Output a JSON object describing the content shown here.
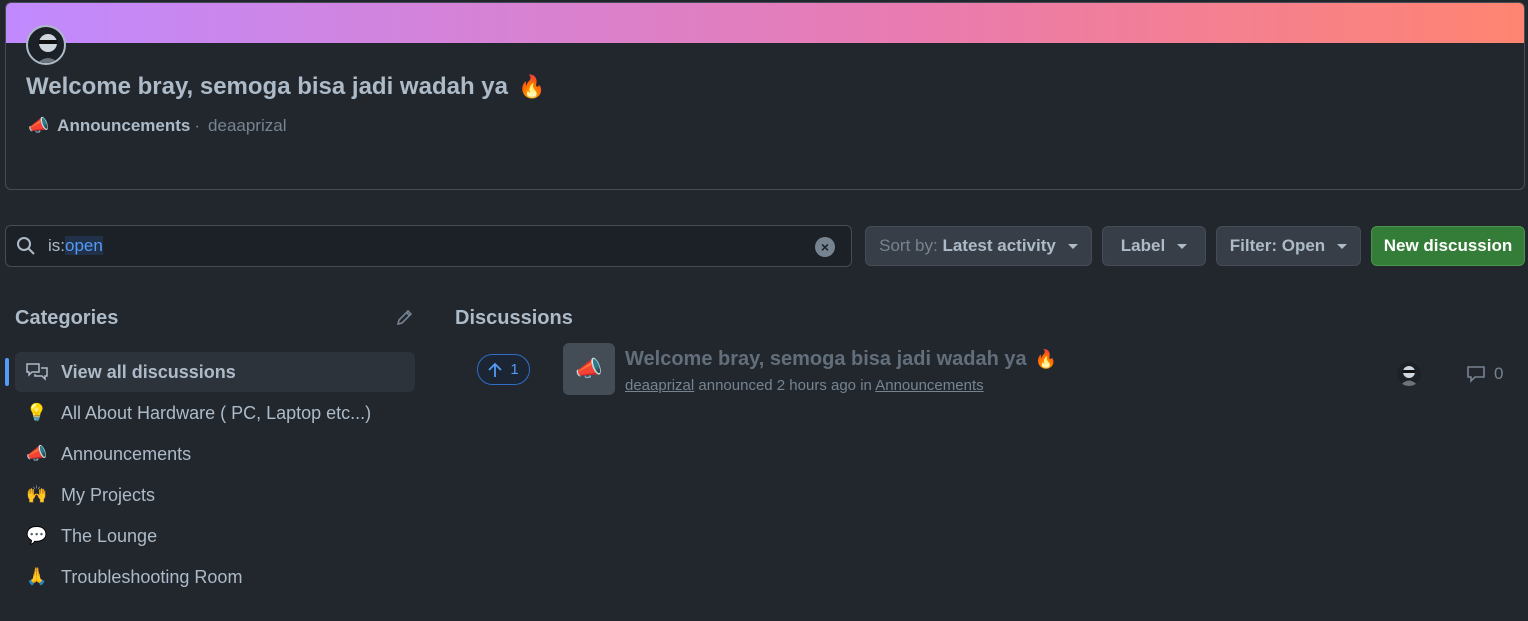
{
  "featured": {
    "title": "Welcome bray, semoga bisa jadi wadah ya",
    "title_emoji": "🔥",
    "category": "Announcements",
    "category_emoji": "📣",
    "separator": "·",
    "author": "deaaprizal"
  },
  "search": {
    "prefix": "is:",
    "value": "open"
  },
  "toolbar": {
    "sort_prefix": "Sort by:",
    "sort_value": "Latest activity",
    "label_button": "Label",
    "filter_button": "Filter: Open",
    "new_discussion": "New discussion"
  },
  "sidebar": {
    "heading": "Categories",
    "items": [
      {
        "label": "View all discussions",
        "emoji": ""
      },
      {
        "label": "All About Hardware ( PC, Laptop etc...)",
        "emoji": "💡"
      },
      {
        "label": "Announcements",
        "emoji": "📣"
      },
      {
        "label": "My Projects",
        "emoji": "🙌"
      },
      {
        "label": "The Lounge",
        "emoji": "💬"
      },
      {
        "label": "Troubleshooting Room",
        "emoji": "🙏"
      }
    ]
  },
  "discussions": {
    "heading": "Discussions",
    "items": [
      {
        "votes": "1",
        "category_emoji": "📣",
        "title": "Welcome bray, semoga bisa jadi wadah ya",
        "title_emoji": "🔥",
        "author": "deaaprizal",
        "action": "announced 2 hours ago in",
        "category": "Announcements",
        "comments": "0"
      }
    ]
  },
  "colors": {
    "accent": "#539bf5",
    "primary_button": "#347d39",
    "background": "#22272e"
  }
}
